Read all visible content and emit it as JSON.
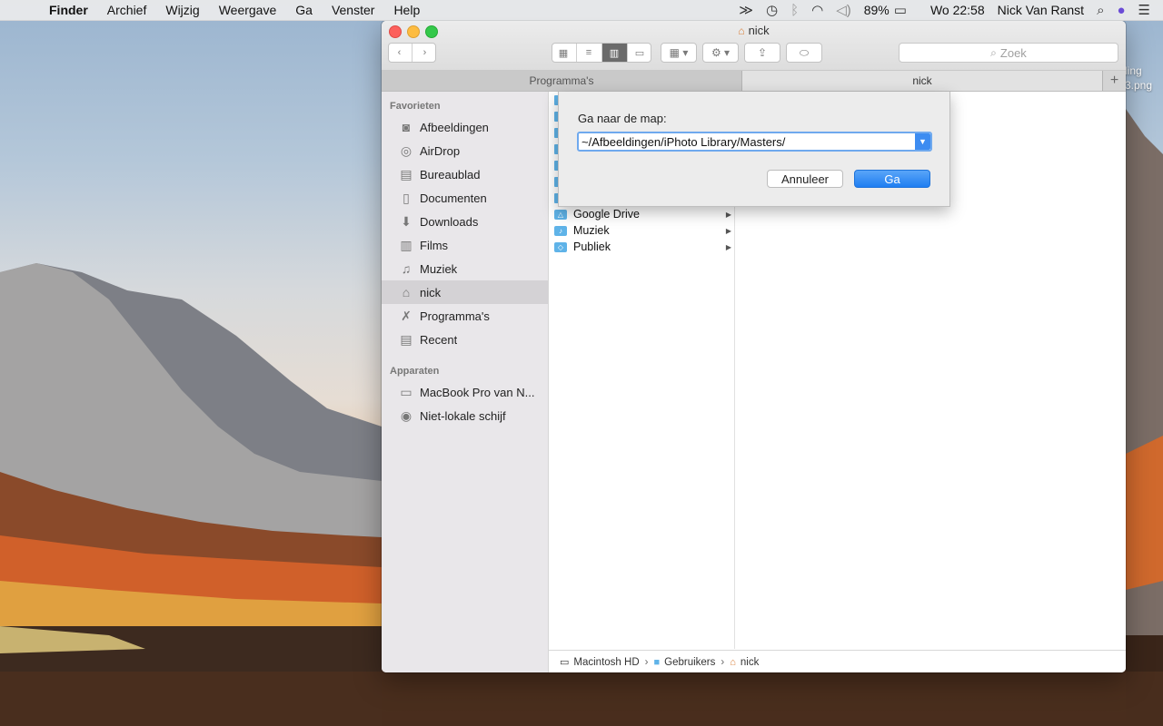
{
  "menubar": {
    "app": "Finder",
    "items": [
      "Archief",
      "Wijzig",
      "Weergave",
      "Ga",
      "Venster",
      "Help"
    ],
    "battery": "89%",
    "clock": "Wo 22:58",
    "user": "Nick Van Ranst"
  },
  "desktop": {
    "file_label_1": "ling",
    "file_label_2": "3.png"
  },
  "window": {
    "title": "nick",
    "search_placeholder": "Zoek",
    "tabs": [
      "Programma's",
      "nick"
    ],
    "add_tab": "+"
  },
  "sidebar": {
    "favorites_header": "Favorieten",
    "favorites": [
      "Afbeeldingen",
      "AirDrop",
      "Bureaublad",
      "Documenten",
      "Downloads",
      "Films",
      "Muziek",
      "nick",
      "Programma's",
      "Recent"
    ],
    "devices_header": "Apparaten",
    "devices": [
      "MacBook Pro van N...",
      "Niet-lokale schijf"
    ]
  },
  "column1": {
    "items": [
      "Google Drive",
      "Muziek",
      "Publiek"
    ]
  },
  "pathbar": {
    "items": [
      "Macintosh HD",
      "Gebruikers",
      "nick"
    ]
  },
  "sheet": {
    "prompt": "Ga naar de map:",
    "value": "~/Afbeeldingen/iPhoto Library/Masters/",
    "cancel_label": "Annuleer",
    "go_label": "Ga"
  },
  "colors": {
    "accent": "#1f7ef1",
    "folder": "#5fb3e8",
    "close": "#fc605c",
    "minimize": "#fdbc40",
    "maximize": "#34c84a"
  }
}
